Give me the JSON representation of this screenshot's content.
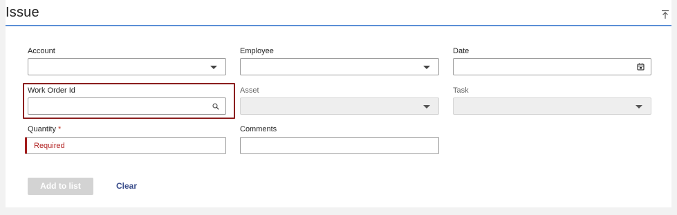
{
  "header": {
    "title": "Issue"
  },
  "form": {
    "account": {
      "label": "Account",
      "value": ""
    },
    "employee": {
      "label": "Employee",
      "value": ""
    },
    "date": {
      "label": "Date",
      "value": ""
    },
    "work_order_id": {
      "label": "Work Order Id",
      "value": ""
    },
    "asset": {
      "label": "Asset",
      "value": ""
    },
    "task": {
      "label": "Task",
      "value": ""
    },
    "quantity": {
      "label": "Quantity",
      "required_mark": "*",
      "error_text": "Required"
    },
    "comments": {
      "label": "Comments",
      "value": ""
    }
  },
  "actions": {
    "add_label": "Add to list",
    "clear_label": "Clear"
  },
  "icons": {
    "collapse": "collapse-up-icon",
    "calendar": "calendar-icon",
    "search": "search-icon",
    "dropdown": "chevron-down-icon"
  },
  "colors": {
    "accent_underline": "#5b8fd6",
    "error": "#b22222",
    "focus_outline": "#8b1e1e",
    "link": "#3b4e8c",
    "disabled_button": "#d3d3d3"
  }
}
